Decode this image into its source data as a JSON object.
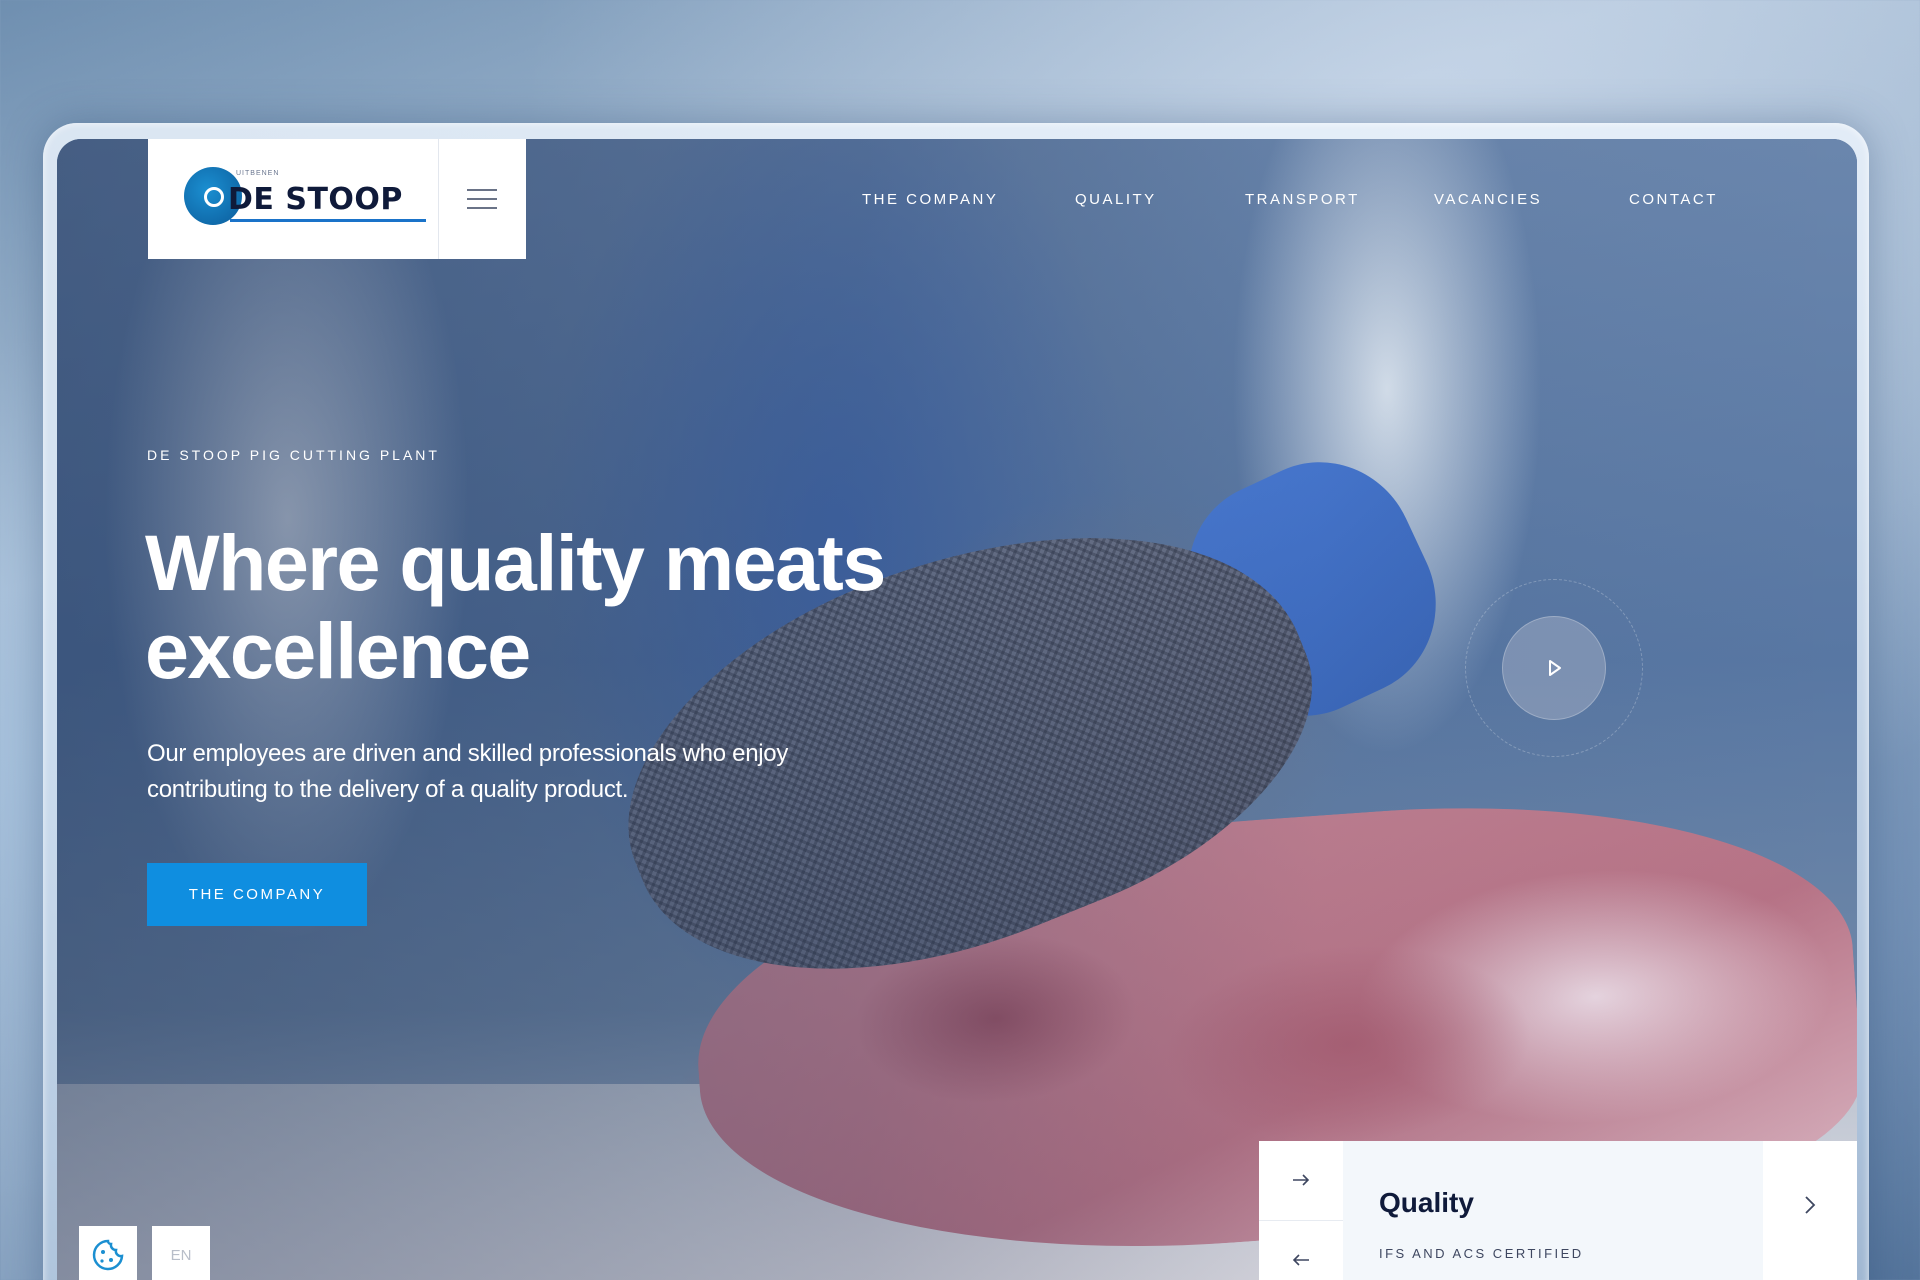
{
  "brand": {
    "logo_text": "DE STOOP",
    "logo_small_text": "UITBENEN",
    "accent_color": "#0f8ee0",
    "brand_dark": "#0f1a3a"
  },
  "header": {
    "menu_icon": "hamburger-icon",
    "nav": [
      {
        "label": "THE COMPANY"
      },
      {
        "label": "QUALITY"
      },
      {
        "label": "TRANSPORT"
      },
      {
        "label": "VACANCIES"
      },
      {
        "label": "CONTACT"
      }
    ]
  },
  "hero": {
    "eyebrow": "DE STOOP PIG CUTTING PLANT",
    "headline_line1": "Where quality meats",
    "headline_line2": "excellence",
    "subtext_line1": "Our employees are driven and skilled professionals who enjoy",
    "subtext_line2": "contributing to the delivery of a quality product.",
    "cta_label": "THE COMPANY",
    "play_icon": "play-icon"
  },
  "footer_controls": {
    "cookie_icon": "cookie-icon",
    "language": "EN"
  },
  "slider": {
    "prev_icon": "arrow-right-icon",
    "next_icon": "arrow-left-icon",
    "title": "Quality",
    "subtitle": "IFS AND ACS CERTIFIED",
    "chevron_icon": "chevron-right-icon"
  }
}
